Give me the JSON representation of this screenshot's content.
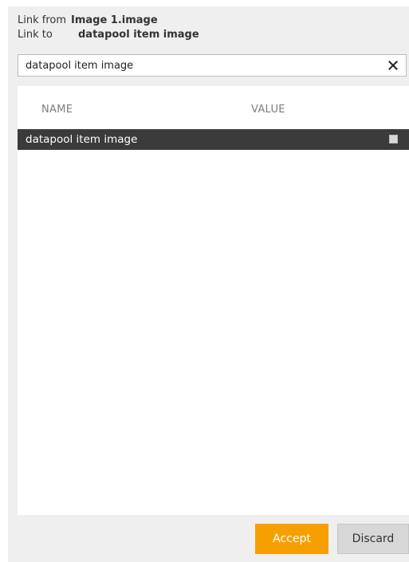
{
  "link": {
    "from_label": "Link from",
    "from_value": "Image 1.image",
    "to_label": "Link to",
    "to_value": "datapool item image"
  },
  "search": {
    "value": "datapool item image",
    "clear_icon": "close-icon"
  },
  "list": {
    "columns": [
      "NAME",
      "VALUE"
    ],
    "rows": [
      {
        "name": "datapool item image",
        "selected": true
      }
    ]
  },
  "buttons": {
    "accept": "Accept",
    "discard": "Discard"
  },
  "colors": {
    "accent": "#f5a000",
    "selected_row": "#3b3b3b",
    "panel_bg": "#efefef"
  }
}
